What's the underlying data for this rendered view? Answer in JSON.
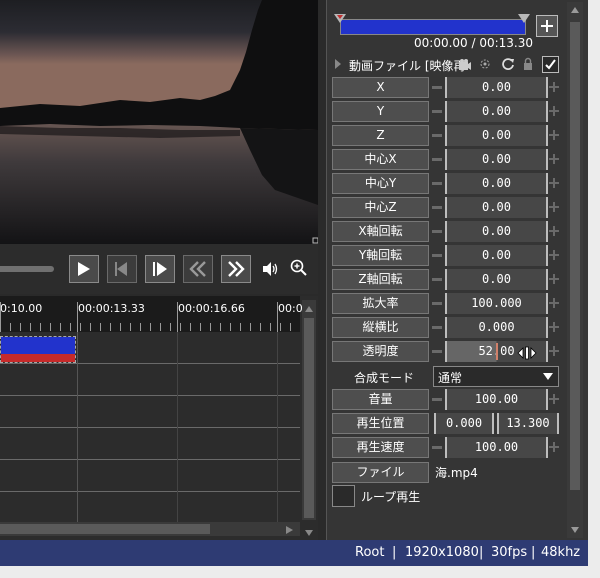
{
  "header": {
    "time_display": "00:00.00 / 00:13.30",
    "object_title": "動画ファイル [映像再"
  },
  "timeline": {
    "labels": [
      "0:10.00",
      "00:00:13.33",
      "00:00:16.66",
      "00:0"
    ]
  },
  "properties": [
    {
      "label": "X",
      "value": "0.00"
    },
    {
      "label": "Y",
      "value": "0.00"
    },
    {
      "label": "Z",
      "value": "0.00"
    },
    {
      "label": "中心X",
      "value": "0.00"
    },
    {
      "label": "中心Y",
      "value": "0.00"
    },
    {
      "label": "中心Z",
      "value": "0.00"
    },
    {
      "label": "X軸回転",
      "value": "0.00"
    },
    {
      "label": "Y軸回転",
      "value": "0.00"
    },
    {
      "label": "Z軸回転",
      "value": "0.00"
    },
    {
      "label": "拡大率",
      "value": "100.000"
    },
    {
      "label": "縦横比",
      "value": "0.000"
    },
    {
      "label": "透明度",
      "value": "52.00"
    }
  ],
  "blend": {
    "label": "合成モード",
    "value": "通常"
  },
  "volume": {
    "label": "音量",
    "value": "100.00"
  },
  "playback_position": {
    "label": "再生位置",
    "start": "0.000",
    "end": "13.300"
  },
  "playback_speed": {
    "label": "再生速度",
    "value": "100.00"
  },
  "file": {
    "label": "ファイル",
    "value": "海.mp4"
  },
  "loop": {
    "label": "ループ再生"
  },
  "status": {
    "root": "Root",
    "sep1": "|",
    "resolution": "1920x1080",
    "sep2": "|",
    "fps": "30fps",
    "sep3": "|",
    "audio": "48khz"
  },
  "colors": {
    "status_bar": "#2e3b73",
    "clip_blue": "#2233cc",
    "clip_red": "#c62a2a"
  }
}
